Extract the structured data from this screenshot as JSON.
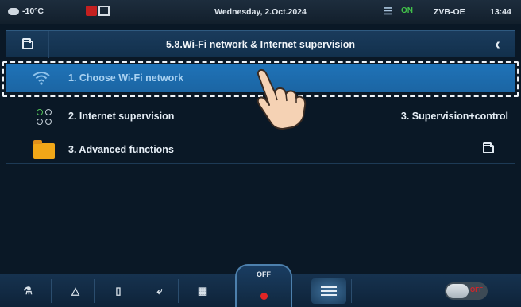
{
  "statusbar": {
    "temperature": "-10°C",
    "date": "Wednesday, 2.Oct.2024",
    "signal_label": "ON",
    "device_name": "ZVB-OE",
    "time": "13:44"
  },
  "titlebar": {
    "title": "5.8.Wi-Fi network & Internet supervision"
  },
  "menu": {
    "items": [
      {
        "label": "1. Choose Wi-Fi network",
        "value": "",
        "icon": "wifi-icon"
      },
      {
        "label": "2. Internet supervision",
        "value": "3. Supervision+control",
        "icon": "dots-icon"
      },
      {
        "label": "3. Advanced functions",
        "value": "",
        "icon": "folder-icon"
      }
    ]
  },
  "bottombar": {
    "off_label": "OFF",
    "toggle_label": "OFF"
  },
  "colors": {
    "selected_row": "#1f73b8",
    "background": "#0a1826",
    "accent_red": "#e02525",
    "folder_yellow": "#f1a718"
  }
}
